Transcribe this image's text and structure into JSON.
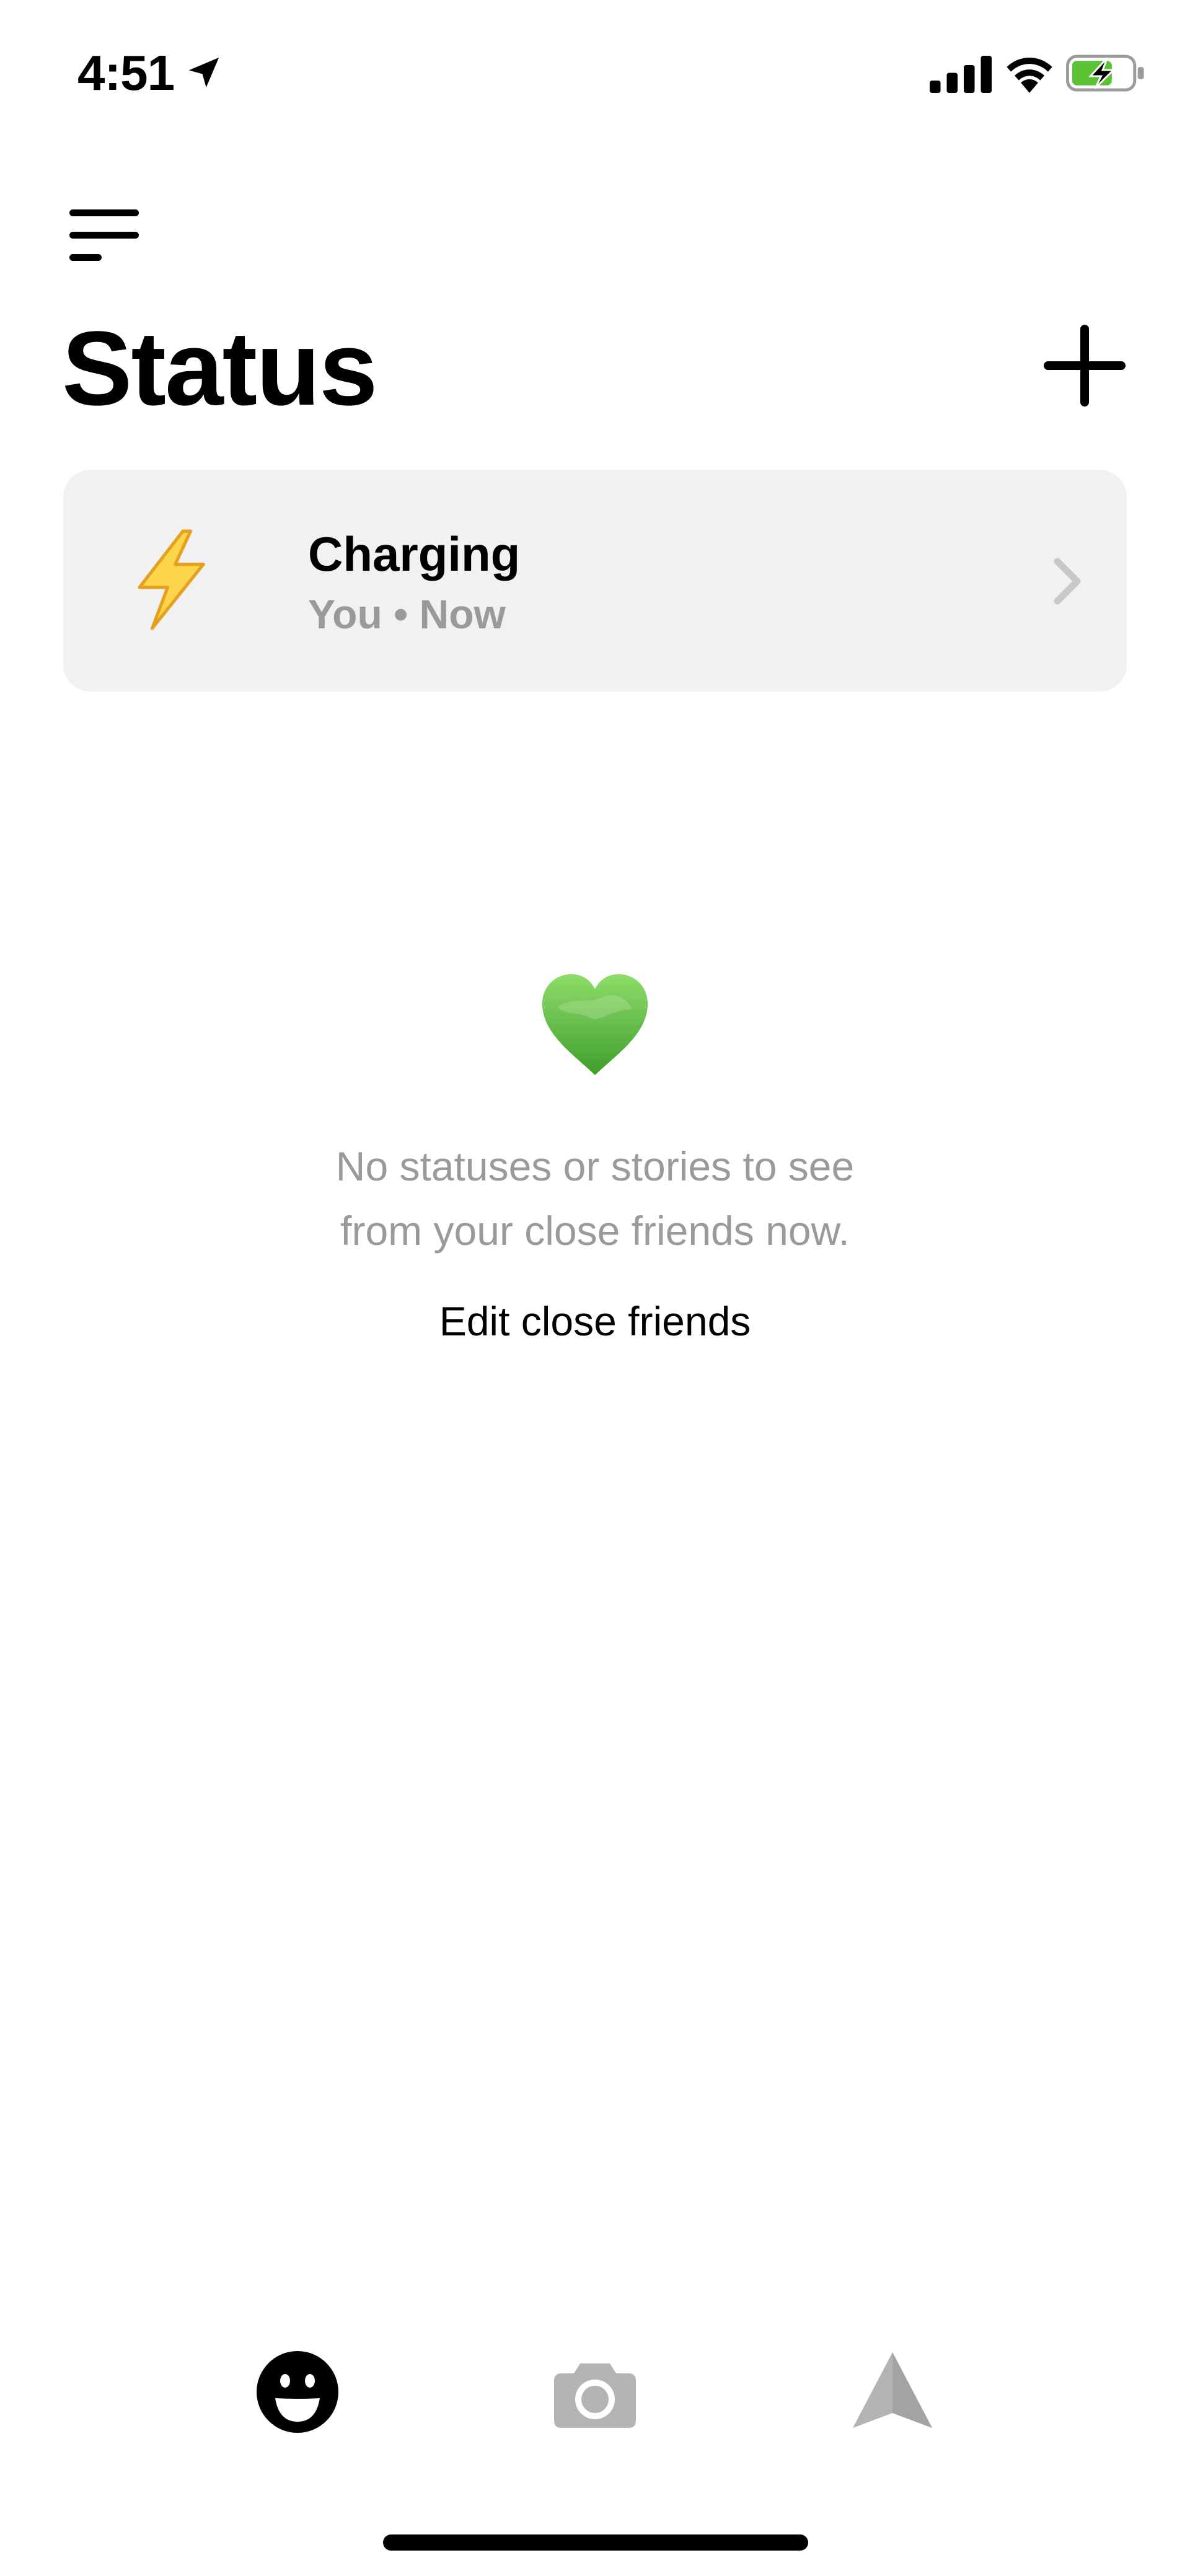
{
  "status_bar": {
    "time": "4:51",
    "icons": [
      "location-arrow-icon",
      "cellular-signal-icon",
      "wifi-icon",
      "battery-charging-icon"
    ],
    "battery_color": "#5bc236"
  },
  "header": {
    "menu_icon": "menu-icon",
    "title": "Status",
    "add_icon": "plus-icon"
  },
  "status_card": {
    "icon": "lightning-bolt-icon",
    "title": "Charging",
    "subtitle": "You • Now",
    "chevron_icon": "chevron-right-icon",
    "background": "#f1f1f1"
  },
  "empty_state": {
    "icon": "green-heart-icon",
    "message_line1": "No statuses or stories to see",
    "message_line2": "from your close friends now.",
    "action_label": "Edit close friends"
  },
  "tab_bar": {
    "tabs": [
      {
        "id": "status",
        "icon": "smiley-face-icon",
        "active": true
      },
      {
        "id": "camera",
        "icon": "camera-icon",
        "active": false
      },
      {
        "id": "send",
        "icon": "send-arrow-icon",
        "active": false
      }
    ],
    "active_color": "#000000",
    "inactive_color": "#b3b3b3"
  }
}
